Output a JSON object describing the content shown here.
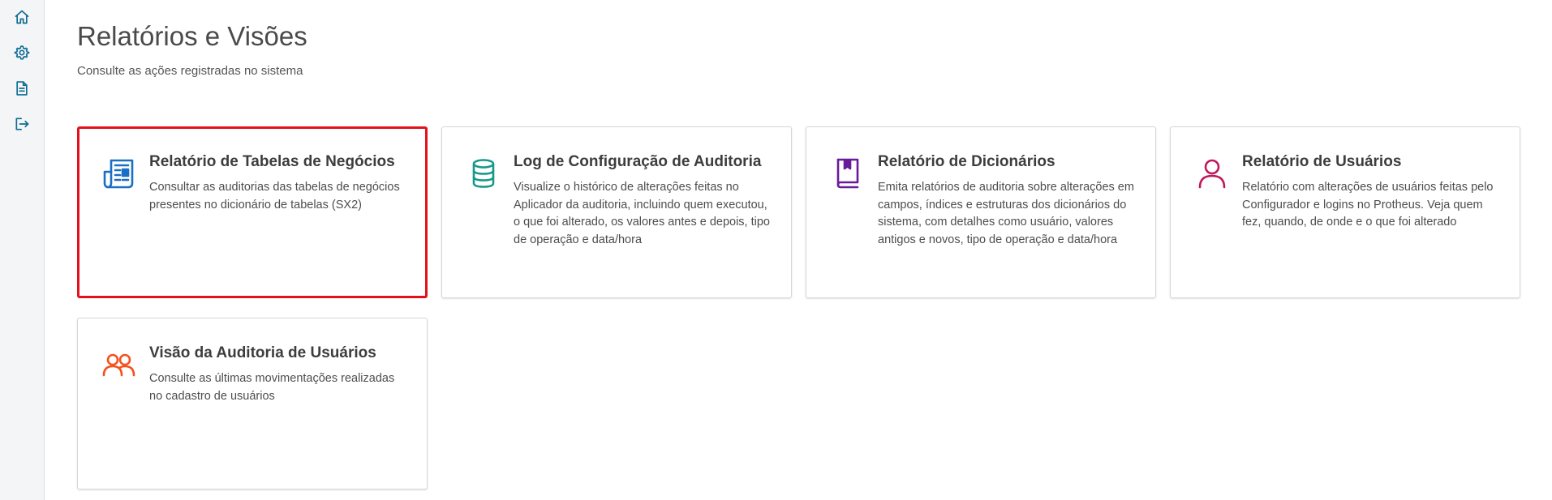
{
  "sidebar": {
    "items": [
      {
        "icon": "home-icon"
      },
      {
        "icon": "gear-icon"
      },
      {
        "icon": "document-icon"
      },
      {
        "icon": "logout-icon"
      }
    ],
    "icon_color": "#0c6c94"
  },
  "header": {
    "title": "Relatórios e Visões",
    "subtitle": "Consulte as ações registradas no sistema"
  },
  "cards": [
    {
      "title": "Relatório de Tabelas de Negócios",
      "description": "Consultar as auditorias das tabelas de negócios presentes no dicionário de tabelas (SX2)",
      "icon": "newspaper-icon",
      "icon_color": "#1a6fc4",
      "selected": true
    },
    {
      "title": "Log de Configuração de Auditoria",
      "description": "Visualize o histórico de alterações feitas no Aplicador da auditoria, incluindo quem executou, o que foi alterado, os valores antes e depois, tipo de operação e data/hora",
      "icon": "database-icon",
      "icon_color": "#17998a",
      "selected": false
    },
    {
      "title": "Relatório de Dicionários",
      "description": "Emita relatórios de auditoria sobre alterações em campos, índices e estruturas dos dicionários do sistema, com detalhes como usuário, valores antigos e novos, tipo de operação e data/hora",
      "icon": "book-icon",
      "icon_color": "#6a1b9a",
      "selected": false
    },
    {
      "title": "Relatório de Usuários",
      "description": "Relatório com alterações de usuários feitas pelo Configurador e logins no Protheus. Veja quem fez, quando, de onde e o que foi alterado",
      "icon": "user-icon",
      "icon_color": "#c2185b",
      "selected": false
    },
    {
      "title": "Visão da Auditoria de Usuários",
      "description": "Consulte as últimas movimentações realizadas no cadastro de usuários",
      "icon": "users-icon",
      "icon_color": "#f4511e",
      "selected": false
    }
  ],
  "colors": {
    "selected_border": "#e3111c",
    "card_border": "#d5d7db",
    "sidebar_bg": "#f4f5f6"
  }
}
